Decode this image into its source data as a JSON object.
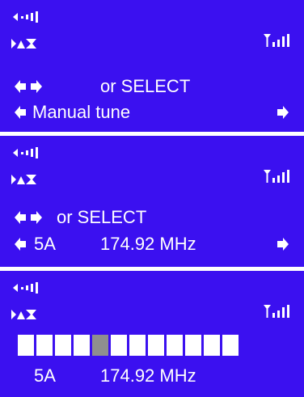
{
  "icons": {
    "volume": "volume-level-icon",
    "dab": "dab-logo",
    "signal": "signal-strength-icon",
    "left": "left-arrow-icon",
    "right": "right-arrow-icon"
  },
  "colors": {
    "screen_bg": "#3b10f0",
    "text": "#ffffff",
    "segment_active": "#8f8f8f",
    "segment_inactive": "#ffffff"
  },
  "screen1": {
    "instruction": "or SELECT",
    "menu_item": "Manual tune"
  },
  "screen2": {
    "instruction": "or SELECT",
    "channel": "5A",
    "frequency": "174.92 MHz"
  },
  "screen3": {
    "segment_count": 12,
    "active_segment_index": 4,
    "channel": "5A",
    "frequency": "174.92 MHz"
  }
}
